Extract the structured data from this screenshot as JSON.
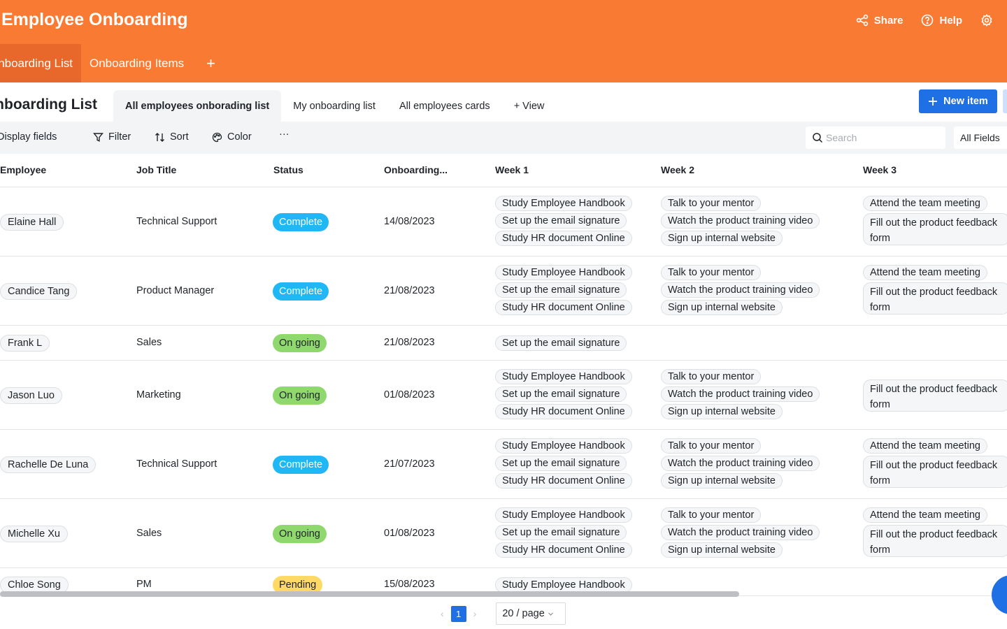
{
  "header": {
    "app_title": "Employee Onboarding",
    "share_label": "Share",
    "help_label": "Help",
    "tabs": [
      {
        "label": "Onboarding List"
      },
      {
        "label": "Onboarding Items"
      }
    ],
    "add_tab": "+"
  },
  "view": {
    "title": "Onboarding List",
    "tabs": [
      {
        "label": "All employees onborading list"
      },
      {
        "label": "My onboarding list"
      },
      {
        "label": "All employees cards"
      },
      {
        "label": "+ View"
      }
    ],
    "new_item_label": "New item"
  },
  "toolbar": {
    "display_fields": "Display fields",
    "filter": "Filter",
    "sort": "Sort",
    "color": "Color",
    "more": "···",
    "search_placeholder": "Search",
    "all_fields": "All Fields"
  },
  "table": {
    "columns": [
      "Employee",
      "Job Title",
      "Status",
      "Onboarding...",
      "Week 1",
      "Week 2",
      "Week 3"
    ],
    "rows": [
      {
        "employee": "Elaine Hall",
        "job": "Technical Support",
        "status": "Complete",
        "date": "14/08/2023",
        "week1": [
          "Study Employee Handbook",
          "Set up the email signature",
          "Study HR document Online"
        ],
        "week2": [
          "Talk to your mentor",
          "Watch the product training video",
          "Sign up internal website"
        ],
        "week3": [
          "Attend the team meeting",
          "Fill out the product feedback form"
        ]
      },
      {
        "employee": "Candice Tang",
        "job": "Product Manager",
        "status": "Complete",
        "date": "21/08/2023",
        "week1": [
          "Study Employee Handbook",
          "Set up the email signature",
          "Study HR document Online"
        ],
        "week2": [
          "Talk to your mentor",
          "Watch the product training video",
          "Sign up internal website"
        ],
        "week3": [
          "Attend the team meeting",
          "Fill out the product feedback form"
        ]
      },
      {
        "employee": "Frank L",
        "job": "Sales",
        "status": "On going",
        "date": "21/08/2023",
        "week1": [
          "Set up the email signature"
        ],
        "week2": [],
        "week3": []
      },
      {
        "employee": "Jason Luo",
        "job": "Marketing",
        "status": "On going",
        "date": "01/08/2023",
        "week1": [
          "Study Employee Handbook",
          "Set up the email signature",
          "Study HR document Online"
        ],
        "week2": [
          "Talk to your mentor",
          "Watch the product training video",
          "Sign up internal website"
        ],
        "week3": [
          "Fill out the product feedback form"
        ]
      },
      {
        "employee": "Rachelle De Luna",
        "job": "Technical Support",
        "status": "Complete",
        "date": "21/07/2023",
        "week1": [
          "Study Employee Handbook",
          "Set up the email signature",
          "Study HR document Online"
        ],
        "week2": [
          "Talk to your mentor",
          "Watch the product training video",
          "Sign up internal website"
        ],
        "week3": [
          "Attend the team meeting",
          "Fill out the product feedback form"
        ]
      },
      {
        "employee": "Michelle Xu",
        "job": "Sales",
        "status": "On going",
        "date": "01/08/2023",
        "week1": [
          "Study Employee Handbook",
          "Set up the email signature",
          "Study HR document Online"
        ],
        "week2": [
          "Talk to your mentor",
          "Watch the product training video",
          "Sign up internal website"
        ],
        "week3": [
          "Attend the team meeting",
          "Fill out the product feedback form"
        ]
      },
      {
        "employee": "Chloe Song",
        "job": "PM",
        "status": "Pending",
        "date": "15/08/2023",
        "week1": [
          "Study Employee Handbook"
        ],
        "week2": [],
        "week3": []
      }
    ]
  },
  "status_colors": {
    "Complete": {
      "bg": "#1fb8f5",
      "fg": "#ffffff"
    },
    "On going": {
      "bg": "#8fd86e",
      "fg": "#1f2329"
    },
    "Pending": {
      "bg": "#ffd966",
      "fg": "#1f2329"
    }
  },
  "pagination": {
    "prev": "‹",
    "current_page": "1",
    "next": "›",
    "page_size": "20 / page"
  },
  "icons": {
    "share": "share-icon",
    "help": "help-icon",
    "settings": "gear-icon",
    "search": "search-icon",
    "filter": "filter-icon",
    "sort": "sort-icon",
    "color": "palette-icon",
    "chat": "chat-icon"
  }
}
